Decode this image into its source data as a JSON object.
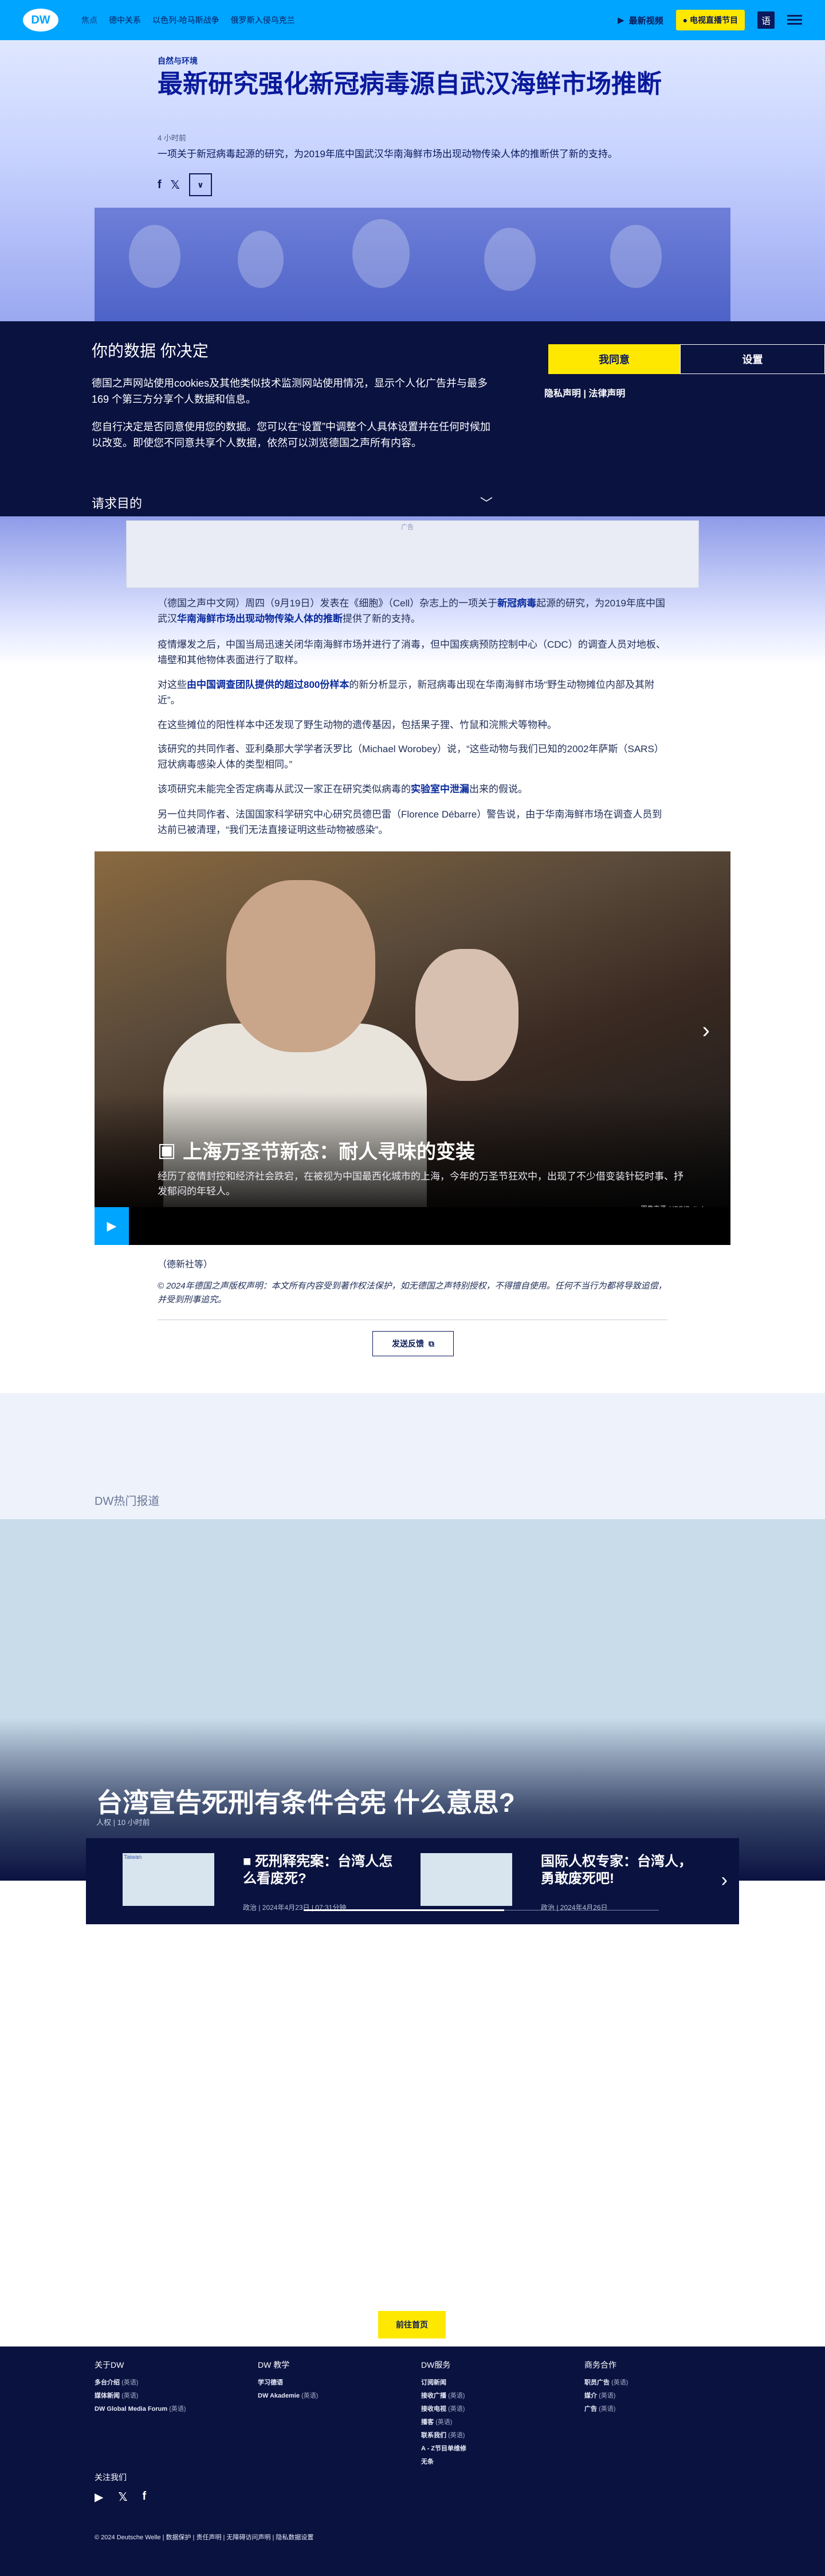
{
  "header": {
    "logo": "DW",
    "nav": [
      "焦点",
      "德中关系",
      "以色列-哈马斯战争",
      "俄罗斯入侵乌克兰"
    ],
    "live_label": "最新视频",
    "tv_label": "电视直播节目",
    "lang_icon": "语"
  },
  "article": {
    "kicker": "自然与环境",
    "title": "最新研究强化新冠病毒源自武汉海鲜市场推断",
    "time": "4 小时前",
    "lead": "一项关于新冠病毒起源的研究，为2019年底中国武汉华南海鲜市场出现动物传染人体的推断供了新的支持。",
    "share": [
      "f",
      "𝕏",
      "∨"
    ]
  },
  "cookie": {
    "title": "你的数据 你决定",
    "para1": "德国之声网站使用cookies及其他类似技术监测网站使用情况，显示个人化广告并与最多169 个第三方分享个人数据和信息。",
    "para2": "您自行决定是否同意使用您的数据。您可以在“设置”中调整个人具体设置并在任何时候加以改变。即使您不同意共享个人数据，依然可以浏览德国之声所有内容。",
    "accept_label": "我同意",
    "settings_label": "设置",
    "links": "隐私声明 | 法律声明",
    "purpose_label": "请求目的",
    "purpose_chev": "﹀"
  },
  "ad_label": "广告",
  "body": {
    "p1a": "（德国之声中文网）周四（9月19日）发表在《细胞》（Cell）杂志上的一项关于",
    "p1b": "新冠病毒",
    "p1c": "起源的研究，为2019年底中国武汉",
    "p1d": "华南海鲜市场出现动物传染人体的推断",
    "p1e": "提供了新的支持。",
    "p2": "疫情爆发之后，中国当局迅速关闭华南海鲜市场并进行了消毒，但中国疾病预防控制中心（CDC）的调查人员对地板、墙壁和其他物体表面进行了取样。",
    "p3a": "对这些",
    "p3b": "由中国调查团队提供的超过800份样本",
    "p3c": "的新分析显示，新冠病毒出现在华南海鲜市场“野生动物摊位内部及其附近”。",
    "p4": "在这些摊位的阳性样本中还发现了野生动物的遗传基因，包括果子狸、竹鼠和浣熊犬等物种。",
    "p5": "该研究的共同作者、亚利桑那大学学者沃罗比（Michael Worobey）说，“这些动物与我们已知的2002年萨斯（SARS）冠状病毒感染人体的类型相同。”",
    "p6a": "该项研究未能完全否定病毒从武汉一家正在研究类似病毒的",
    "p6b": "实验室中泄漏",
    "p6c": "出来的假说。",
    "p7": "另一位共同作者、法国国家科学研究中心研究员德巴雷（Florence Débarre）警告说，由于华南海鲜市场在调查人员到达前已被清理，“我们无法直接证明这些动物被感染”。"
  },
  "gallery": {
    "title": "上海万圣节新态：耐人寻味的变装",
    "caption": "经历了疫情封控和经济社会跌宕，在被视为中国最西化城市的上海，今年的万圣节狂欢中，出现了不少借变装针砭时事、抒发郁闷的年轻人。",
    "credit": "图像来源: VCG/Getty Images"
  },
  "source": "（德新社等）",
  "copyright": "© 2024年德国之声版权声明：本文所有内容受到著作权法保护，如无德国之声特别授权，不得擅自使用。任何不当行为都将导致追偿，并受到刑事追究。",
  "feedback_label": "发送反馈",
  "popular": {
    "label": "DW热门报道",
    "title": "台湾宣告死刑有条件合宪 什么意思?",
    "meta": "人权 | 10 小时前",
    "cards": [
      {
        "title": "死刑释宪案：台湾人怎么看废死?",
        "meta": "政治 | 2024年4月23日 | 07:31分钟",
        "thumb": "Taiwan"
      },
      {
        "title": "国际人权专家：台湾人，勇敢废死吧!",
        "meta": "政治 | 2024年4月26日",
        "thumb": ""
      }
    ]
  },
  "home_label": "前往首页",
  "footer": {
    "cols": [
      {
        "title": "关于DW",
        "items": [
          [
            "多台介绍",
            "(英语)"
          ],
          [
            "媒体新闻",
            "(英语)"
          ],
          [
            "DW Global Media Forum",
            "(英语)"
          ]
        ]
      },
      {
        "title": "DW 教学",
        "items": [
          [
            "学习德语",
            ""
          ],
          [
            "DW Akademie",
            "(英语)"
          ]
        ]
      },
      {
        "title": "DW服务",
        "items": [
          [
            "订阅新闻",
            ""
          ],
          [
            "接收广播",
            "(英语)"
          ],
          [
            "接收电视",
            "(英语)"
          ],
          [
            "播客",
            "(英语)"
          ],
          [
            "联系我们",
            "(英语)"
          ],
          [
            "A - Z节目单维修",
            ""
          ],
          [
            "无条",
            ""
          ]
        ]
      },
      {
        "title": "商务合作",
        "items": [
          [
            "职员广告",
            "(英语)"
          ],
          [
            "媒介",
            "(英语)"
          ],
          [
            "广告",
            "(英语)"
          ]
        ]
      }
    ],
    "follow": "关注我们",
    "legal": "© 2024 Deutsche Welle  |  数据保护  |  责任声明  |  无障碍访问声明  |  隐私数据设置"
  }
}
